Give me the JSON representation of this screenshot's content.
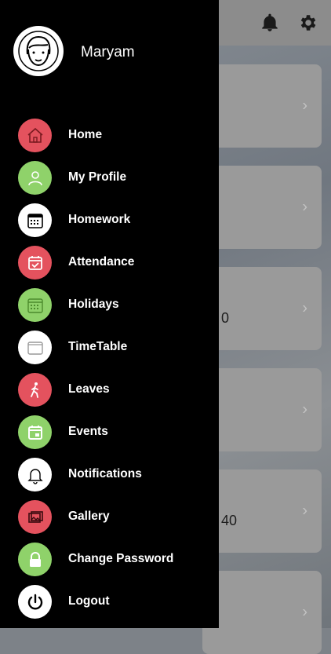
{
  "user": {
    "name": "Maryam"
  },
  "menu": {
    "items": [
      {
        "label": "Home",
        "icon": "home-icon",
        "color": "#e4525e"
      },
      {
        "label": "My Profile",
        "icon": "profile-icon",
        "color": "#8fd26a"
      },
      {
        "label": "Homework",
        "icon": "calendar-grid-icon",
        "color": "#ffffff"
      },
      {
        "label": "Attendance",
        "icon": "calendar-check-icon",
        "color": "#e4525e"
      },
      {
        "label": "Holidays",
        "icon": "calendar-icon",
        "color": "#8fd26a"
      },
      {
        "label": "TimeTable",
        "icon": "table-icon",
        "color": "#ffffff"
      },
      {
        "label": "Leaves",
        "icon": "walking-icon",
        "color": "#e4525e"
      },
      {
        "label": "Events",
        "icon": "event-icon",
        "color": "#8fd26a"
      },
      {
        "label": "Notifications",
        "icon": "bell-icon",
        "color": "#ffffff"
      },
      {
        "label": "Gallery",
        "icon": "gallery-icon",
        "color": "#e4525e"
      },
      {
        "label": "Change Password",
        "icon": "lock-icon",
        "color": "#8fd26a"
      },
      {
        "label": "Logout",
        "icon": "power-icon",
        "color": "#ffffff"
      }
    ]
  },
  "background": {
    "card_values": [
      "0",
      "40"
    ]
  }
}
